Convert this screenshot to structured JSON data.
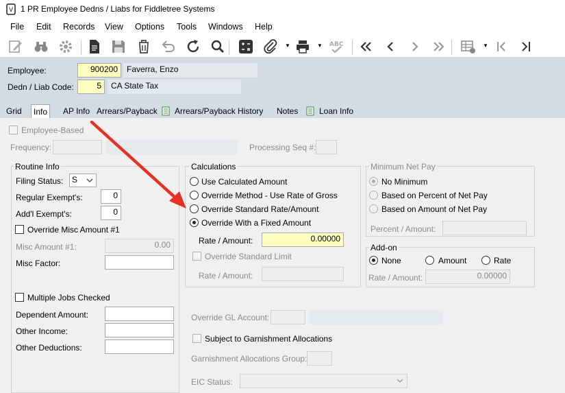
{
  "window": {
    "title": "1 PR Employee Dedns / Liabs for Fiddletree Systems"
  },
  "menu": [
    "File",
    "Edit",
    "Records",
    "View",
    "Options",
    "Tools",
    "Windows",
    "Help"
  ],
  "toolbar_icons": [
    "edit-icon",
    "binoculars-icon",
    "gear-icon",
    "document-icon",
    "save-icon",
    "delete-icon",
    "undo-icon",
    "refresh-icon",
    "search-icon",
    "calculator-icon",
    "attachment-icon",
    "printer-icon",
    "spellcheck-icon",
    "first-record-icon",
    "previous-record-icon",
    "next-record-icon",
    "last-record-icon",
    "grid-view-icon",
    "first-icon",
    "last-icon"
  ],
  "header": {
    "employee_label": "Employee:",
    "employee_id": "900200",
    "employee_name": "Faverra, Enzo",
    "dedn_label": "Dedn / Liab Code:",
    "dedn_code": "5",
    "dedn_name": "CA State Tax"
  },
  "tabs": [
    "Grid",
    "Info",
    "AP Info",
    "Arrears/Payback",
    "Arrears/Payback History",
    "Notes",
    "Loan Info"
  ],
  "active_tab": "Info",
  "top": {
    "employee_based": "Employee-Based",
    "frequency_label": "Frequency:",
    "processing_seq_label": "Processing Seq #:"
  },
  "routine": {
    "title": "Routine Info",
    "filing_status_label": "Filing Status:",
    "filing_status_value": "S",
    "regular_exempts_label": "Regular Exempt's:",
    "regular_exempts_value": "0",
    "addl_exempts_label": "Add'l Exempt's:",
    "addl_exempts_value": "0",
    "override_misc_label": "Override Misc Amount #1",
    "misc_amount_label": "Misc Amount #1:",
    "misc_amount_value": "0.00",
    "misc_factor_label": "Misc Factor:",
    "multiple_jobs_label": "Multiple Jobs Checked",
    "dependent_amount_label": "Dependent Amount:",
    "other_income_label": "Other Income:",
    "other_deductions_label": "Other Deductions:"
  },
  "calc": {
    "title": "Calculations",
    "opt1": "Use Calculated Amount",
    "opt2": "Override Method - Use Rate of Gross",
    "opt3": "Override Standard Rate/Amount",
    "opt4": "Override With a Fixed Amount",
    "selected": 4,
    "rate_label": "Rate / Amount:",
    "rate_value": "0.00000",
    "override_limit_label": "Override Standard Limit",
    "limit_rate_label": "Rate / Amount:"
  },
  "minnet": {
    "title": "Minimum Net Pay",
    "opt1": "No Minimum",
    "opt2": "Based on Percent of Net Pay",
    "opt3": "Based on Amount of Net Pay",
    "percent_label": "Percent / Amount:"
  },
  "addon": {
    "title": "Add-on",
    "opt1": "None",
    "opt2": "Amount",
    "opt3": "Rate",
    "rate_label": "Rate / Amount:",
    "rate_value": "0.00000"
  },
  "lower": {
    "override_gl_label": "Override GL Account:",
    "garnishment_label": "Subject to Garnishment Allocations",
    "garnishment_group_label": "Garnishment Allocations Group:",
    "eic_label": "EIC Status:"
  },
  "colors": {
    "header_bg": "#d3dce5",
    "highlight": "#ffffc0",
    "annotation_arrow": "#e53224"
  }
}
